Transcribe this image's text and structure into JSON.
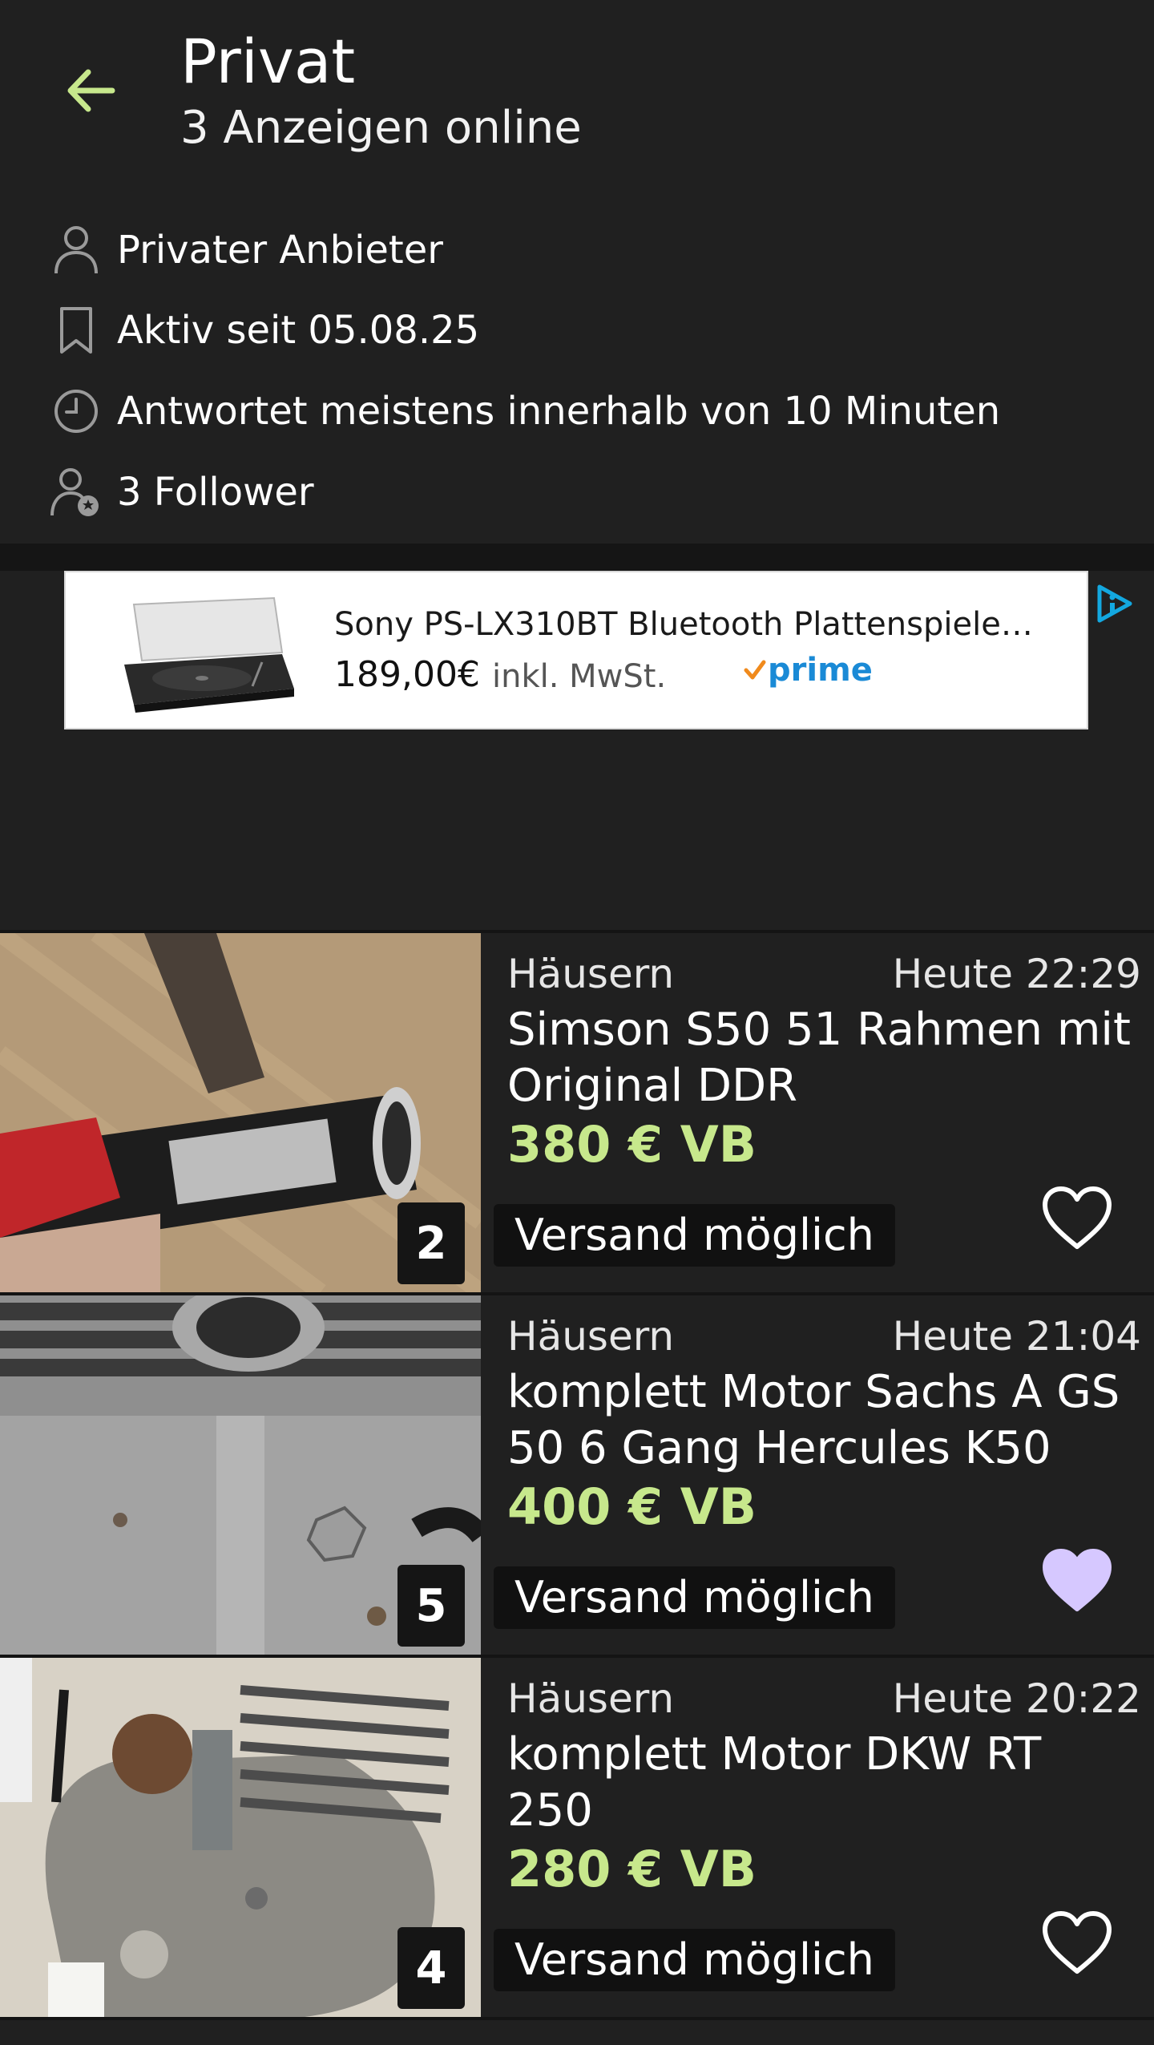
{
  "header": {
    "title": "Privat",
    "subtitle": "3 Anzeigen online",
    "accent_color": "#c7e88c"
  },
  "seller_info": [
    {
      "icon": "person-icon",
      "text": "Privater Anbieter"
    },
    {
      "icon": "bookmark-icon",
      "text": "Aktiv seit 05.08.25"
    },
    {
      "icon": "clock-icon",
      "text": "Antwortet meistens innerhalb von 10 Minuten"
    },
    {
      "icon": "follower-icon",
      "text": "3 Follower"
    }
  ],
  "ad": {
    "title": "Sony PS-LX310BT Bluetooth Plattenspieler…",
    "price": "189,00€",
    "tax_note": "inkl. MwSt.",
    "badge": "prime",
    "badge_color": "#1a8ad6"
  },
  "listings": [
    {
      "location": "Häusern",
      "time": "Heute 22:29",
      "title": "Simson S50 51 Rahmen mit Original DDR",
      "price": "380 € VB",
      "shipping": "Versand möglich",
      "image_count": "2",
      "favorited": false
    },
    {
      "location": "Häusern",
      "time": "Heute 21:04",
      "title": "komplett Motor Sachs A GS 50 6 Gang Hercules K50",
      "price": "400 € VB",
      "shipping": "Versand möglich",
      "image_count": "5",
      "favorited": true
    },
    {
      "location": "Häusern",
      "time": "Heute 20:22",
      "title": "komplett Motor DKW RT 250",
      "price": "280 € VB",
      "shipping": "Versand möglich",
      "image_count": "4",
      "favorited": false
    }
  ],
  "colors": {
    "background": "#202020",
    "price": "#c7e88c",
    "favorite_active": "#d6c8ff"
  }
}
